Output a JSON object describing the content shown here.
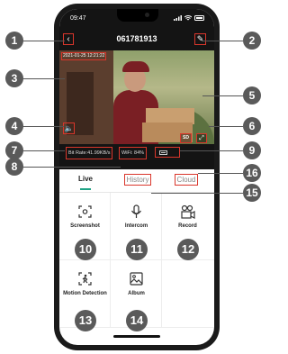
{
  "status_bar": {
    "time": "09:47"
  },
  "header": {
    "title": "061781913",
    "back_icon": "back-arrow-icon",
    "edit_icon": "pencil-icon"
  },
  "video": {
    "timestamp": "2021-01-25 12:21:22",
    "sd_label": "SD"
  },
  "info": {
    "bit_rate": "Bit Rate:41.99KB/s",
    "wifi": "WiFi: 84%"
  },
  "tabs": [
    {
      "label": "Live"
    },
    {
      "label": "History"
    },
    {
      "label": "Cloud"
    }
  ],
  "grid": [
    {
      "label": "Screenshot",
      "icon": "screenshot-icon"
    },
    {
      "label": "Intercom",
      "icon": "microphone-icon"
    },
    {
      "label": "Record",
      "icon": "record-camera-icon"
    },
    {
      "label": "Motion Detection",
      "icon": "motion-detection-icon"
    },
    {
      "label": "Album",
      "icon": "album-icon"
    }
  ],
  "callouts": [
    "1",
    "2",
    "3",
    "4",
    "5",
    "6",
    "7",
    "8",
    "9",
    "10",
    "11",
    "12",
    "13",
    "14",
    "15",
    "16"
  ],
  "colors": {
    "accent": "#1fa385",
    "highlight": "#d9362b",
    "callout": "#5a5a5a"
  }
}
